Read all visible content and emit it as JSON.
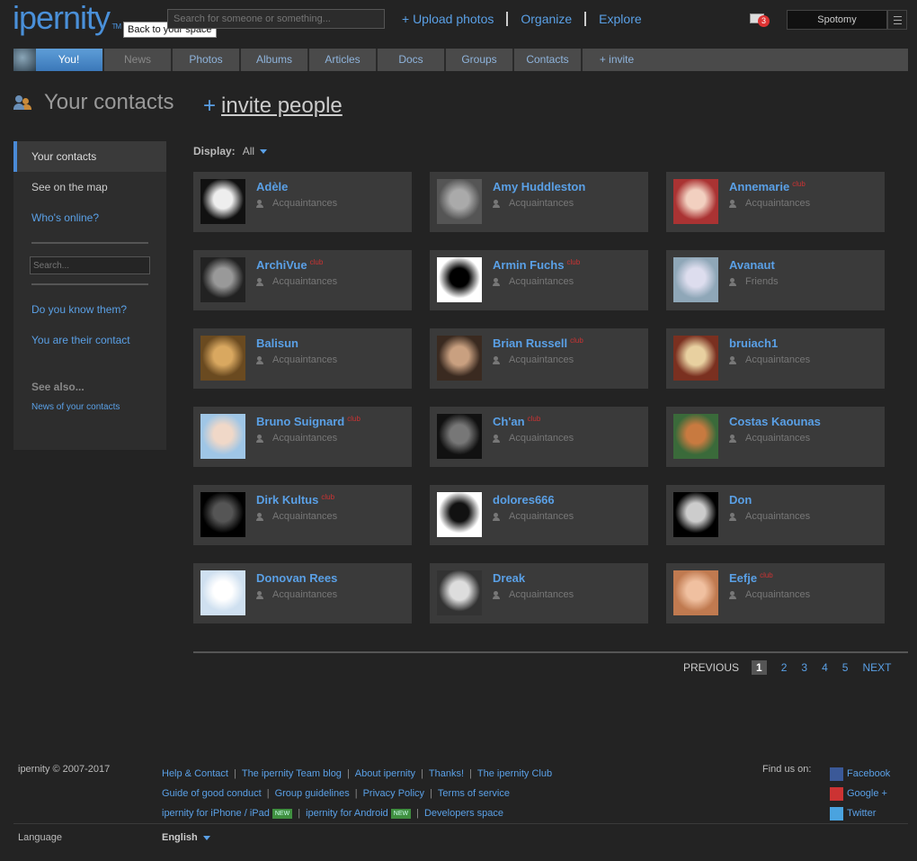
{
  "header": {
    "logo": "ipernity",
    "logo_tm": "TM",
    "tooltip": "Back to your space",
    "search_placeholder": "Search for someone or something...",
    "upload": "+ Upload photos",
    "organize": "Organize",
    "explore": "Explore",
    "mail_count": "3",
    "username": "Spotomy"
  },
  "tabs": {
    "you": "You!",
    "news": "News",
    "photos": "Photos",
    "albums": "Albums",
    "articles": "Articles",
    "docs": "Docs",
    "groups": "Groups",
    "contacts": "Contacts",
    "invite": "+ invite"
  },
  "page": {
    "title": "Your contacts",
    "invite_plus": "+",
    "invite_link": "invite people"
  },
  "sidebar": {
    "your_contacts": "Your contacts",
    "see_map": "See on the map",
    "whos_online": "Who's online?",
    "search_placeholder": "Search...",
    "do_you_know": "Do you know them?",
    "their_contact": "You are their contact",
    "see_also": "See also...",
    "news_contacts": "News of your contacts"
  },
  "display": {
    "label": "Display:",
    "value": "All"
  },
  "club_label": "club",
  "contacts": [
    {
      "name": "Adèle",
      "rel": "Acquaintances",
      "club": false,
      "thumb": [
        "#111",
        "#eee"
      ]
    },
    {
      "name": "Amy Huddleston",
      "rel": "Acquaintances",
      "club": false,
      "thumb": [
        "#555",
        "#aaa"
      ]
    },
    {
      "name": "Annemarie",
      "rel": "Acquaintances",
      "club": true,
      "thumb": [
        "#a33",
        "#f2d0c0"
      ]
    },
    {
      "name": "ArchiVue",
      "rel": "Acquaintances",
      "club": true,
      "thumb": [
        "#222",
        "#999"
      ]
    },
    {
      "name": "Armin Fuchs",
      "rel": "Acquaintances",
      "club": true,
      "thumb": [
        "#fff",
        "#000"
      ]
    },
    {
      "name": "Avanaut",
      "rel": "Friends",
      "club": false,
      "thumb": [
        "#8fa7b8",
        "#dde"
      ]
    },
    {
      "name": "Balisun",
      "rel": "Acquaintances",
      "club": false,
      "thumb": [
        "#6a4a20",
        "#d9a860"
      ]
    },
    {
      "name": "Brian Russell",
      "rel": "Acquaintances",
      "club": true,
      "thumb": [
        "#3a2a20",
        "#c9a080"
      ]
    },
    {
      "name": "bruiach1",
      "rel": "Acquaintances",
      "club": false,
      "thumb": [
        "#7a3020",
        "#e8d0a0"
      ]
    },
    {
      "name": "Bruno Suignard",
      "rel": "Acquaintances",
      "club": true,
      "thumb": [
        "#9fc6e6",
        "#f0d8c8"
      ]
    },
    {
      "name": "Ch'an",
      "rel": "Acquaintances",
      "club": true,
      "thumb": [
        "#111",
        "#777"
      ]
    },
    {
      "name": "Costas Kaounas",
      "rel": "Acquaintances",
      "club": false,
      "thumb": [
        "#3a6a3a",
        "#c87a40"
      ]
    },
    {
      "name": "Dirk Kultus",
      "rel": "Acquaintances",
      "club": true,
      "thumb": [
        "#000",
        "#555"
      ]
    },
    {
      "name": "dolores666",
      "rel": "Acquaintances",
      "club": false,
      "thumb": [
        "#fff",
        "#111"
      ]
    },
    {
      "name": "Don",
      "rel": "Acquaintances",
      "club": false,
      "thumb": [
        "#000",
        "#ccc"
      ]
    },
    {
      "name": "Donovan Rees",
      "rel": "Acquaintances",
      "club": false,
      "thumb": [
        "#cfe0f0",
        "#ffffff"
      ]
    },
    {
      "name": "Dreak",
      "rel": "Acquaintances",
      "club": false,
      "thumb": [
        "#333",
        "#ddd"
      ]
    },
    {
      "name": "Eefje",
      "rel": "Acquaintances",
      "club": true,
      "thumb": [
        "#c07a50",
        "#f0c0a0"
      ]
    }
  ],
  "pager": {
    "prev": "PREVIOUS",
    "pages": [
      "1",
      "2",
      "3",
      "4",
      "5"
    ],
    "current": "1",
    "next": "NEXT"
  },
  "footer": {
    "copyright": "ipernity © 2007-2017",
    "links_row1": [
      "Help & Contact",
      "The ipernity Team blog",
      "About ipernity",
      "Thanks!",
      "The ipernity Club"
    ],
    "links_row2": [
      "Guide of good conduct",
      "Group guidelines",
      "Privacy Policy",
      "Terms of service"
    ],
    "iphone": "ipernity for iPhone / iPad",
    "android": "ipernity for Android",
    "developers": "Developers space",
    "new_badge": "NEW",
    "find_us": "Find us on:",
    "facebook": "Facebook",
    "google": "Google +",
    "twitter": "Twitter",
    "language_label": "Language",
    "language_value": "English"
  }
}
